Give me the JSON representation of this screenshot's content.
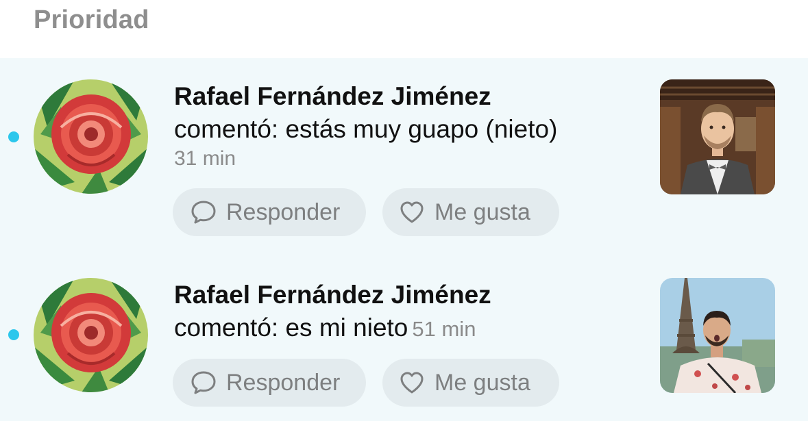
{
  "section": {
    "title": "Prioridad"
  },
  "notifications": [
    {
      "name": "Rafael Fernández Jiménez",
      "comment": "comentó: estás muy guapo (nieto)",
      "time": "31 min",
      "reply_label": "Responder",
      "like_label": "Me gusta",
      "unread": true
    },
    {
      "name": "Rafael Fernández Jiménez",
      "comment": "comentó: es mi nieto",
      "time": "51 min",
      "reply_label": "Responder",
      "like_label": "Me gusta",
      "unread": true
    }
  ],
  "colors": {
    "unread_dot": "#2cc7ec",
    "feed_background": "#f1f9fb",
    "button_background": "#e3ebee"
  },
  "icons": {
    "reply": "speech-bubble-icon",
    "like": "heart-outline-icon"
  }
}
